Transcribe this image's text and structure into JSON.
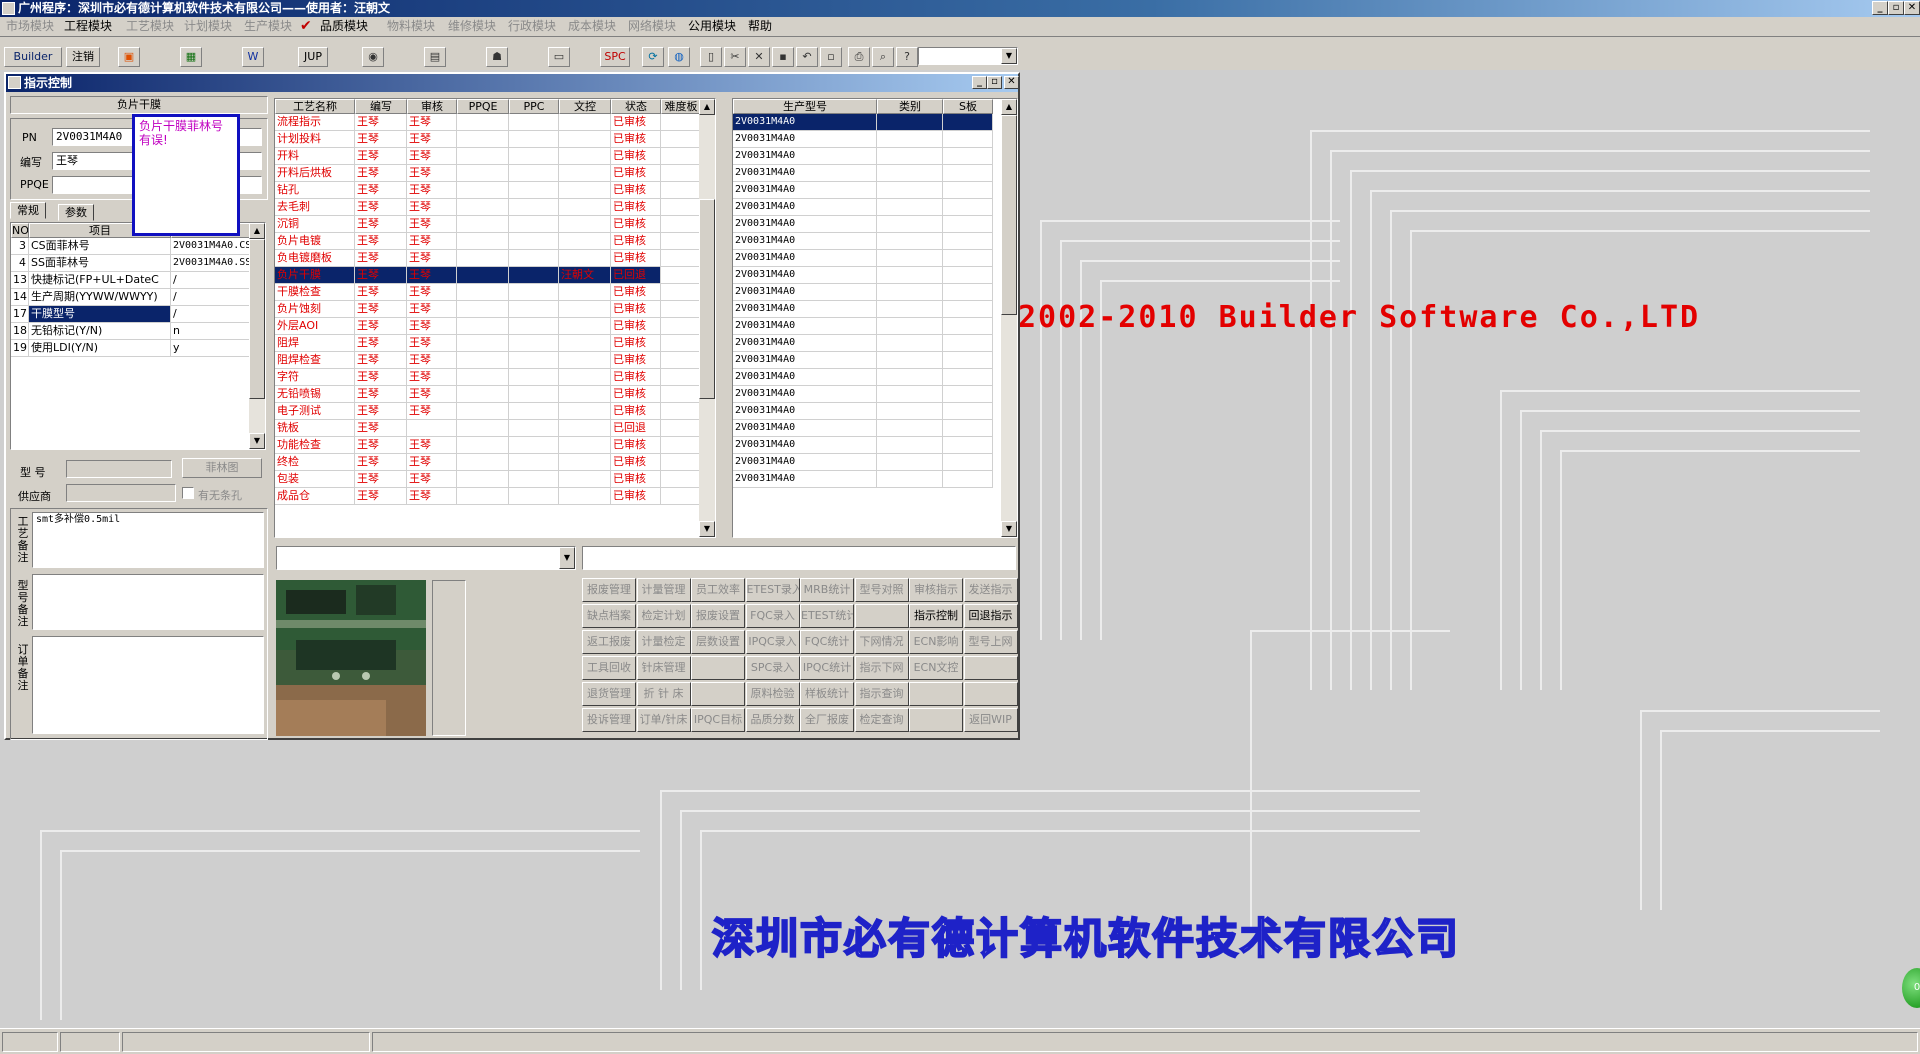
{
  "app": {
    "title": "广州程序：深圳市必有德计算机软件技术有限公司——使用者：汪朝文"
  },
  "menu": [
    {
      "label": "市场模块",
      "enabled": false
    },
    {
      "label": "工程模块",
      "enabled": true
    },
    {
      "label": "工艺模块",
      "enabled": false
    },
    {
      "label": "计划模块",
      "enabled": false
    },
    {
      "label": "生产模块",
      "enabled": false
    },
    {
      "label": "品质模块",
      "enabled": true
    },
    {
      "label": "物料模块",
      "enabled": false
    },
    {
      "label": "维修模块",
      "enabled": false
    },
    {
      "label": "行政模块",
      "enabled": false
    },
    {
      "label": "成本模块",
      "enabled": false
    },
    {
      "label": "网络模块",
      "enabled": false
    },
    {
      "label": "公用模块",
      "enabled": true
    },
    {
      "label": "帮助",
      "enabled": true
    }
  ],
  "toolbar": {
    "builder": "Builder",
    "logout": "注销",
    "jup": "JUP",
    "spc": "SPC"
  },
  "background": {
    "copyright": "2002-2010 Builder Software Co.,LTD",
    "company": "深圳市必有德计算机软件技术有限公司",
    "green_button": "0"
  },
  "dialog": {
    "title": "指示控制",
    "header": "负片干膜",
    "pn_label": "PN",
    "pn_value": "2V0031M4A0",
    "author_label": "编写",
    "author_value": "王琴",
    "ppqe_label": "PPQE",
    "tooltip": "负片干膜菲林号有误!",
    "tabs": [
      "常规",
      "参数"
    ],
    "param_headers": [
      "NO",
      "项目",
      "参数"
    ],
    "params": [
      {
        "no": "3",
        "item": "CS面菲林号",
        "value": "2V0031M4A0.CS"
      },
      {
        "no": "4",
        "item": "SS面菲林号",
        "value": "2V0031M4A0.SS"
      },
      {
        "no": "13",
        "item": "快捷标记(FP+UL+DateC",
        "value": "/"
      },
      {
        "no": "14",
        "item": "生产周期(YYWW/WWYY)",
        "value": "/"
      },
      {
        "no": "17",
        "item": "干膜型号",
        "value": "/"
      },
      {
        "no": "18",
        "item": "无铅标记(Y/N)",
        "value": "n"
      },
      {
        "no": "19",
        "item": "使用LDI(Y/N)",
        "value": "y"
      }
    ],
    "model_label": "型 号",
    "film_button": "菲林图",
    "supplier_label": "供应商",
    "no_hole_label": "有无条孔",
    "process_note_label": "工艺备注",
    "process_note": "smt多补偿0.5mil",
    "model_note_label": "型号备注",
    "order_note_label": "订单备注",
    "process_headers": [
      "工艺名称",
      "编写",
      "审核",
      "PPQE",
      "PPC",
      "文控",
      "状态",
      "难度板"
    ],
    "processes": [
      {
        "name": "流程指示",
        "author": "王琴",
        "review": "王琴",
        "docctl": "",
        "status": "已审核"
      },
      {
        "name": "计划投料",
        "author": "王琴",
        "review": "王琴",
        "docctl": "",
        "status": "已审核"
      },
      {
        "name": "开料",
        "author": "王琴",
        "review": "王琴",
        "docctl": "",
        "status": "已审核"
      },
      {
        "name": "开料后烘板",
        "author": "王琴",
        "review": "王琴",
        "docctl": "",
        "status": "已审核"
      },
      {
        "name": "钻孔",
        "author": "王琴",
        "review": "王琴",
        "docctl": "",
        "status": "已审核"
      },
      {
        "name": "去毛刺",
        "author": "王琴",
        "review": "王琴",
        "docctl": "",
        "status": "已审核"
      },
      {
        "name": "沉铜",
        "author": "王琴",
        "review": "王琴",
        "docctl": "",
        "status": "已审核"
      },
      {
        "name": "负片电镀",
        "author": "王琴",
        "review": "王琴",
        "docctl": "",
        "status": "已审核"
      },
      {
        "name": "负电镀磨板",
        "author": "王琴",
        "review": "王琴",
        "docctl": "",
        "status": "已审核"
      },
      {
        "name": "负片干膜",
        "author": "王琴",
        "review": "王琴",
        "docctl": "汪朝文",
        "status": "已回退"
      },
      {
        "name": "干膜检查",
        "author": "王琴",
        "review": "王琴",
        "docctl": "",
        "status": "已审核"
      },
      {
        "name": "负片蚀刻",
        "author": "王琴",
        "review": "王琴",
        "docctl": "",
        "status": "已审核"
      },
      {
        "name": "外层AOI",
        "author": "王琴",
        "review": "王琴",
        "docctl": "",
        "status": "已审核"
      },
      {
        "name": "阻焊",
        "author": "王琴",
        "review": "王琴",
        "docctl": "",
        "status": "已审核"
      },
      {
        "name": "阻焊检查",
        "author": "王琴",
        "review": "王琴",
        "docctl": "",
        "status": "已审核"
      },
      {
        "name": "字符",
        "author": "王琴",
        "review": "王琴",
        "docctl": "",
        "status": "已审核"
      },
      {
        "name": "无铅喷锡",
        "author": "王琴",
        "review": "王琴",
        "docctl": "",
        "status": "已审核"
      },
      {
        "name": "电子测试",
        "author": "王琴",
        "review": "王琴",
        "docctl": "",
        "status": "已审核"
      },
      {
        "name": "铣板",
        "author": "王琴",
        "review": "",
        "docctl": "",
        "status": "已回退"
      },
      {
        "name": "功能检查",
        "author": "王琴",
        "review": "王琴",
        "docctl": "",
        "status": "已审核"
      },
      {
        "name": "终检",
        "author": "王琴",
        "review": "王琴",
        "docctl": "",
        "status": "已审核"
      },
      {
        "name": "包装",
        "author": "王琴",
        "review": "王琴",
        "docctl": "",
        "status": "已审核"
      },
      {
        "name": "成品仓",
        "author": "王琴",
        "review": "王琴",
        "docctl": "",
        "status": "已审核"
      }
    ],
    "model_headers": [
      "生产型号",
      "类别",
      "S板"
    ],
    "models": [
      "2V0031M4A0",
      "2V0031M4A0",
      "2V0031M4A0",
      "2V0031M4A0",
      "2V0031M4A0",
      "2V0031M4A0",
      "2V0031M4A0",
      "2V0031M4A0",
      "2V0031M4A0",
      "2V0031M4A0",
      "2V0031M4A0",
      "2V0031M4A0",
      "2V0031M4A0",
      "2V0031M4A0",
      "2V0031M4A0",
      "2V0031M4A0",
      "2V0031M4A0",
      "2V0031M4A0",
      "2V0031M4A0",
      "2V0031M4A0",
      "2V0031M4A0",
      "2V0031M4A0"
    ],
    "func_buttons": [
      [
        "报废管理",
        "计量管理",
        "员工效率",
        "ETEST录入",
        "MRB统计",
        "型号对照",
        "审核指示",
        "发送指示"
      ],
      [
        "缺点档案",
        "检定计划",
        "报废设置",
        "FQC录入",
        "ETEST统计",
        "",
        "指示控制",
        "回退指示"
      ],
      [
        "返工报废",
        "计量检定",
        "层数设置",
        "IPQC录入",
        "FQC统计",
        "下网情况",
        "ECN影响",
        "型号上网"
      ],
      [
        "工具回收",
        "针床管理",
        "",
        "SPC录入",
        "IPQC统计",
        "指示下网",
        "ECN文控",
        ""
      ],
      [
        "退货管理",
        "折 针 床",
        "",
        "原料检验",
        "样板统计",
        "指示查询",
        "",
        ""
      ],
      [
        "投诉管理",
        "订单/针床",
        "IPQC目标",
        "品质分数",
        "全厂报废",
        "检定查询",
        "",
        "返回WIP"
      ]
    ],
    "active_buttons": [
      "指示控制",
      "回退指示"
    ]
  }
}
